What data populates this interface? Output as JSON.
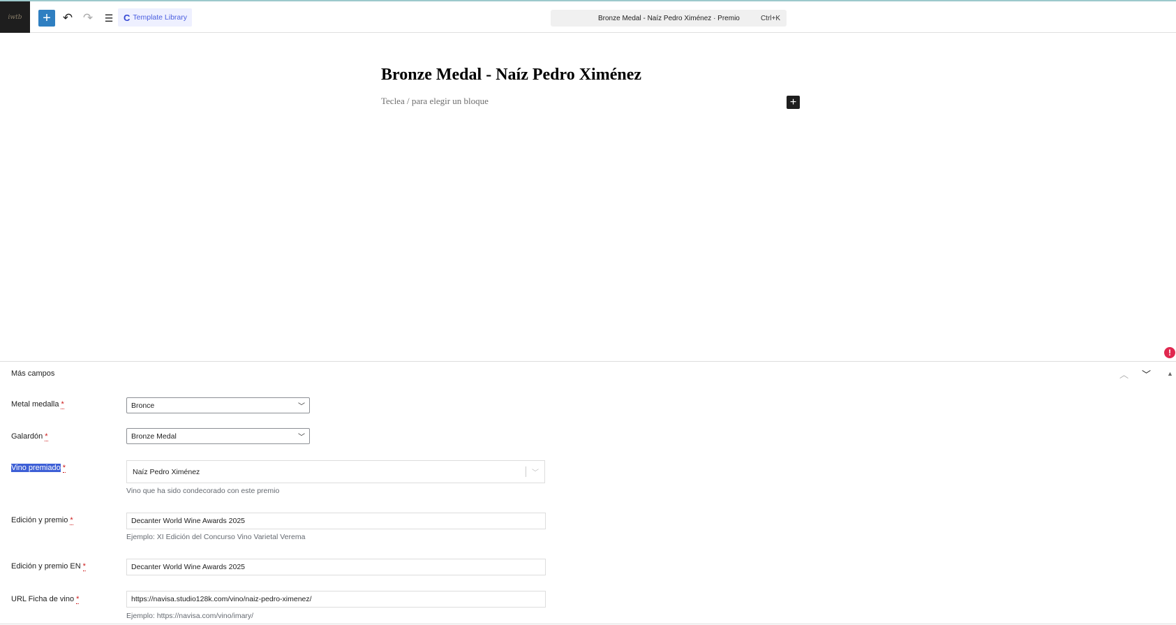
{
  "toolbar": {
    "logo_text": "iwtb",
    "add_label": "+",
    "undo": "↶",
    "redo": "↷",
    "outline": "☰",
    "template_library": "Template Library",
    "template_icon": "C",
    "command_title": "Bronze Medal - Naíz Pedro Ximénez · Premio",
    "command_shortcut": "Ctrl+K"
  },
  "editor": {
    "title": "Bronze Medal - Naíz Pedro Ximénez",
    "placeholder": "Teclea / para elegir un bloque",
    "block_add": "+"
  },
  "alert_icon": "!",
  "panel": {
    "title": "Más campos",
    "fields": [
      {
        "label": "Metal medalla",
        "value": "Bronce"
      },
      {
        "label": "Galardón",
        "value": "Bronze Medal"
      },
      {
        "label": "Vino premiado",
        "value": "Naíz Pedro Ximénez",
        "help": "Vino que ha sido condecorado con este premio"
      },
      {
        "label": "Edición y premio",
        "value": "Decanter World Wine Awards 2025",
        "help": "Ejemplo: XI Edición del Concurso Vino Varietal Verema"
      },
      {
        "label": "Edición y premio EN",
        "value": "Decanter World Wine Awards 2025"
      },
      {
        "label": "URL Ficha de vino",
        "value": "https://navisa.studio128k.com/vino/naiz-pedro-ximenez/",
        "help": "Ejemplo: https://navisa.com/vino/imary/"
      }
    ],
    "required_mark": "*"
  }
}
